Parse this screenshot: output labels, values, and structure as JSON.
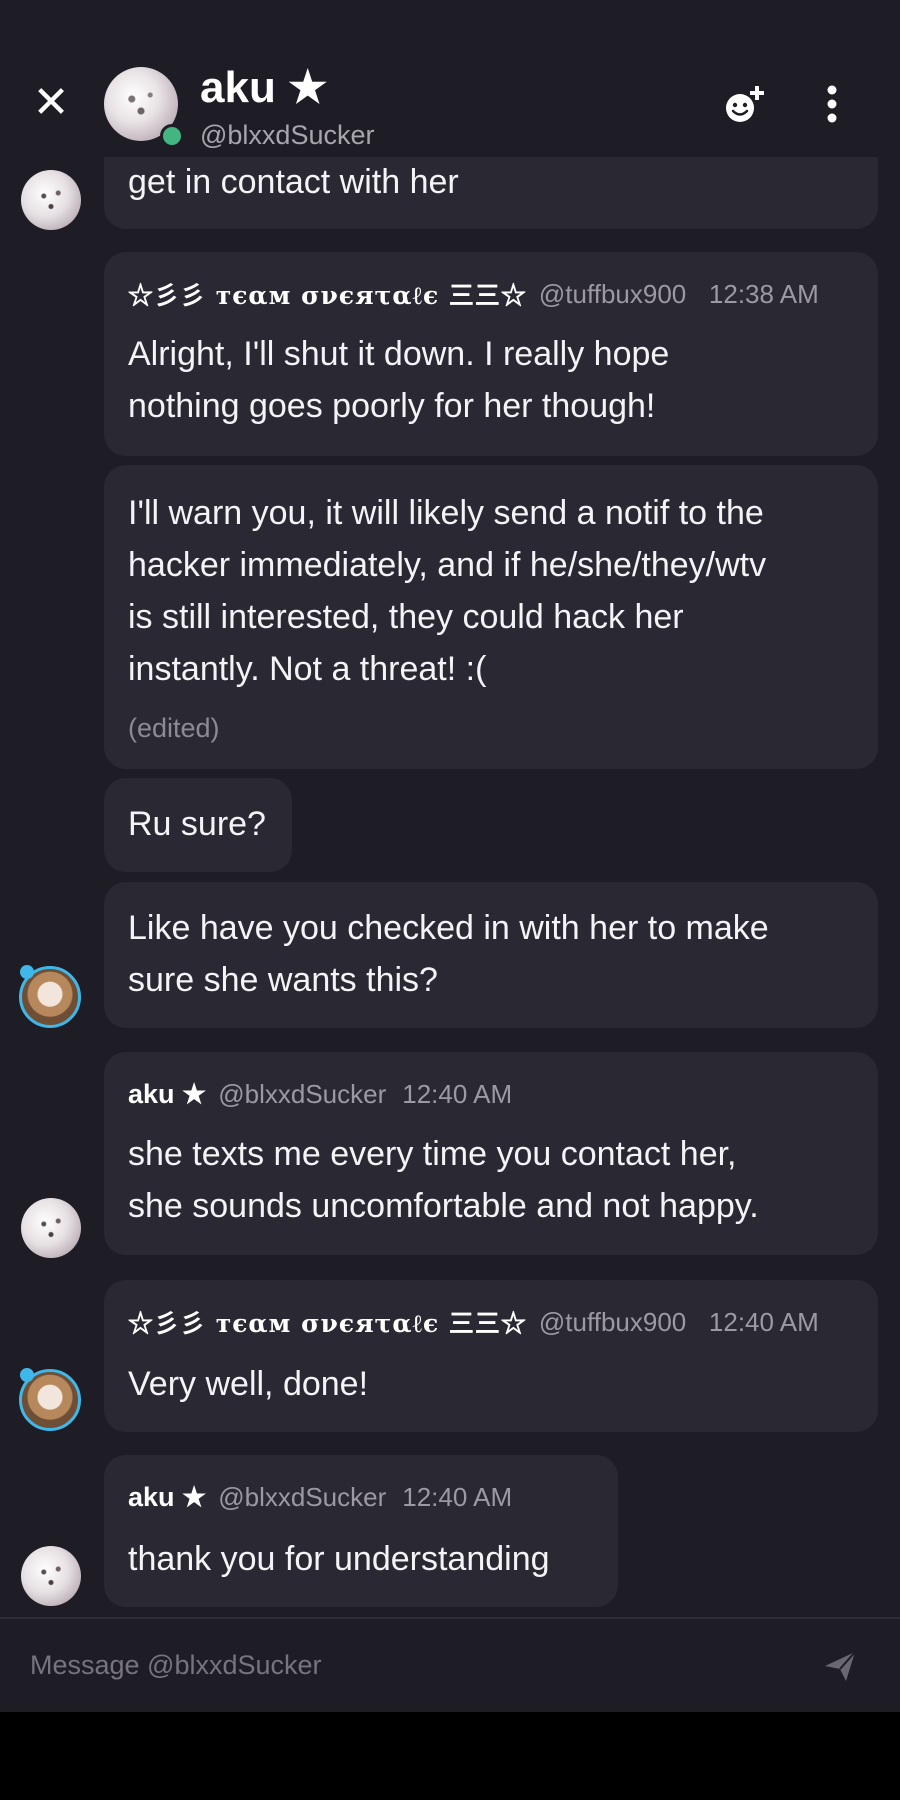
{
  "header": {
    "name": "aku ★",
    "handle": "@blxxdSucker",
    "close_icon": "close-icon",
    "add_friend_icon": "add-friend-icon",
    "more_icon": "more-vertical-icon",
    "status_color": "#43b581"
  },
  "messages": [
    {
      "text_lines": [
        "get in contact with her"
      ]
    },
    {
      "author": "☆彡彡 тєαм σνєяταℓє 三三☆",
      "handle": "@tuffbux900",
      "time": "12:38 AM",
      "text_lines": [
        "Alright, I'll shut it down. I really hope",
        "nothing goes poorly for her though!"
      ]
    },
    {
      "text_lines": [
        "I'll warn you, it will likely send a notif to the",
        "hacker immediately, and if he/she/they/wtv",
        "is still interested, they could hack her",
        "instantly. Not a threat! :("
      ],
      "edited": "(edited)"
    },
    {
      "text_lines": [
        "Ru sure?"
      ]
    },
    {
      "text_lines": [
        "Like have you checked in with her to make",
        "sure she wants this?"
      ]
    },
    {
      "author": "aku ★",
      "handle": "@blxxdSucker",
      "time": "12:40 AM",
      "text_lines": [
        "she texts me every time you contact her,",
        "she sounds uncomfortable and not happy."
      ]
    },
    {
      "author": "☆彡彡 тєαм σνєяταℓє 三三☆",
      "handle": "@tuffbux900",
      "time": "12:40 AM",
      "text_lines": [
        "Very well, done!"
      ]
    },
    {
      "author": "aku ★",
      "handle": "@blxxdSucker",
      "time": "12:40 AM",
      "text_lines": [
        "thank you for understanding"
      ]
    }
  ],
  "composer": {
    "placeholder": "Message @blxxdSucker",
    "send_icon": "send-icon"
  },
  "colors": {
    "background": "#1e1c24",
    "bubble": "#2a2833",
    "accent_ring": "#3fb7e8"
  }
}
